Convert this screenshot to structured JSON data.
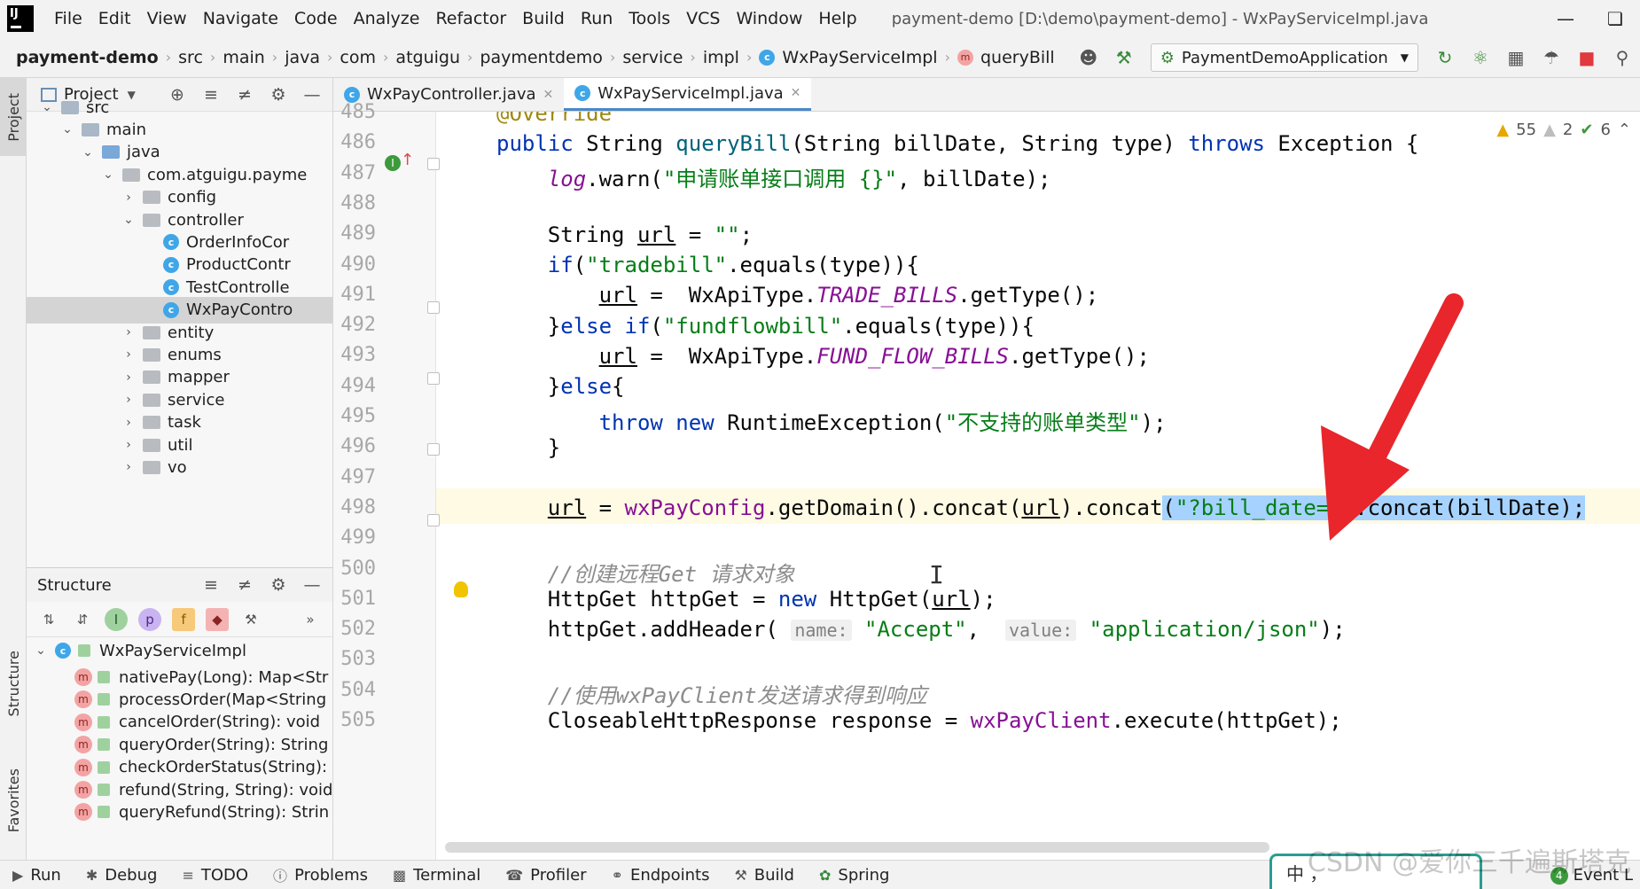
{
  "menubar": {
    "logo": "IJ",
    "items": [
      "File",
      "Edit",
      "View",
      "Navigate",
      "Code",
      "Analyze",
      "Refactor",
      "Build",
      "Run",
      "Tools",
      "VCS",
      "Window",
      "Help"
    ],
    "window_title": "payment-demo [D:\\demo\\payment-demo] - WxPayServiceImpl.java"
  },
  "breadcrumb": [
    "payment-demo",
    "src",
    "main",
    "java",
    "com",
    "atguigu",
    "paymentdemo",
    "service",
    "impl",
    "WxPayServiceImpl",
    "queryBill"
  ],
  "run_config": {
    "label": "PaymentDemoApplication"
  },
  "left_strip": {
    "project": "Project",
    "structure": "Structure",
    "favorites": "Favorites"
  },
  "project_panel": {
    "title": "Project",
    "tree": [
      {
        "label": "src",
        "depth": 1,
        "expanded": true,
        "kind": "folder"
      },
      {
        "label": "main",
        "depth": 2,
        "expanded": true,
        "kind": "folder"
      },
      {
        "label": "java",
        "depth": 3,
        "expanded": true,
        "kind": "folder-blue"
      },
      {
        "label": "com.atguigu.payme",
        "depth": 4,
        "expanded": true,
        "kind": "package"
      },
      {
        "label": "config",
        "depth": 5,
        "expanded": false,
        "kind": "package"
      },
      {
        "label": "controller",
        "depth": 5,
        "expanded": true,
        "kind": "package"
      },
      {
        "label": "OrderInfoCor",
        "depth": 6,
        "kind": "class"
      },
      {
        "label": "ProductContr",
        "depth": 6,
        "kind": "class"
      },
      {
        "label": "TestControlle",
        "depth": 6,
        "kind": "class"
      },
      {
        "label": "WxPayContro",
        "depth": 6,
        "kind": "class",
        "selected": true
      },
      {
        "label": "entity",
        "depth": 5,
        "expanded": false,
        "kind": "package"
      },
      {
        "label": "enums",
        "depth": 5,
        "expanded": false,
        "kind": "package"
      },
      {
        "label": "mapper",
        "depth": 5,
        "expanded": false,
        "kind": "package"
      },
      {
        "label": "service",
        "depth": 5,
        "expanded": false,
        "kind": "package"
      },
      {
        "label": "task",
        "depth": 5,
        "expanded": false,
        "kind": "package"
      },
      {
        "label": "util",
        "depth": 5,
        "expanded": false,
        "kind": "package"
      },
      {
        "label": "vo",
        "depth": 5,
        "expanded": false,
        "kind": "package"
      }
    ]
  },
  "structure_panel": {
    "title": "Structure",
    "root": "WxPayServiceImpl",
    "methods": [
      "nativePay(Long): Map<Str",
      "processOrder(Map<String",
      "cancelOrder(String): void",
      "queryOrder(String): String",
      "checkOrderStatus(String):",
      "refund(String, String): void",
      "queryRefund(String): Strin"
    ]
  },
  "editor": {
    "tabs": [
      {
        "label": "WxPayController.java",
        "active": false
      },
      {
        "label": "WxPayServiceImpl.java",
        "active": true
      }
    ],
    "inspections": {
      "warnings": "55",
      "weak_warnings": "2",
      "ok": "6"
    },
    "line_numbers": [
      "485",
      "486",
      "487",
      "488",
      "489",
      "490",
      "491",
      "492",
      "493",
      "494",
      "495",
      "496",
      "497",
      "498",
      "499",
      "500",
      "501",
      "502",
      "503",
      "504",
      "505"
    ]
  },
  "bottombar": {
    "items": [
      "Run",
      "Debug",
      "TODO",
      "Problems",
      "Terminal",
      "Profiler",
      "Endpoints",
      "Build",
      "Spring"
    ],
    "event_log": "Event L",
    "event_count": "4"
  },
  "overlay": {
    "ime": "中 ，",
    "watermark": "CSDN @爱你三千遍斯塔克"
  },
  "colors": {
    "keyword": "#0033b3",
    "string": "#067d17",
    "annotation": "#9e880d",
    "selection": "#a6d2ff",
    "arrow": "#e8262b"
  }
}
